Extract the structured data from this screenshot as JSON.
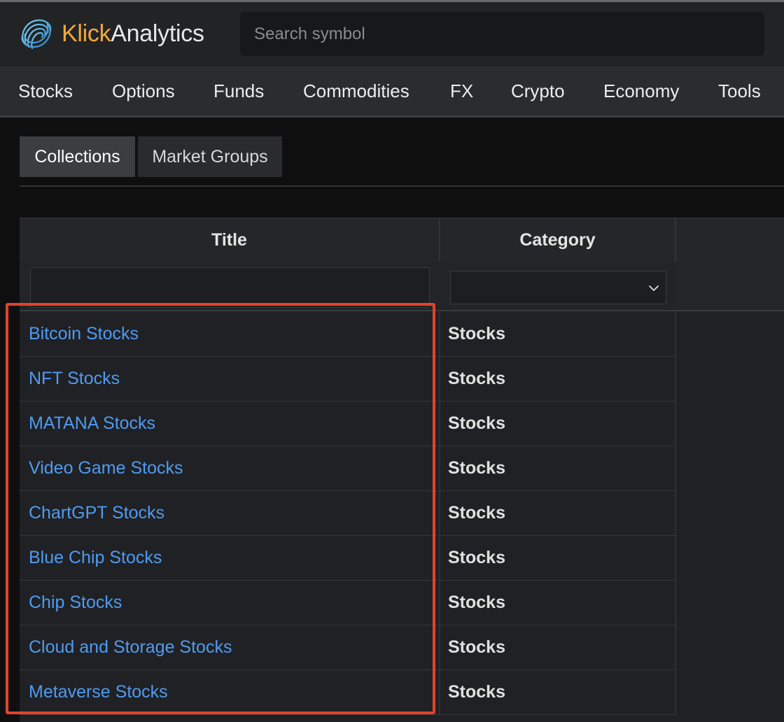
{
  "header": {
    "brand_part1": "Klick",
    "brand_part2": "Analytics",
    "search_placeholder": "Search symbol"
  },
  "nav": [
    "Stocks",
    "Options",
    "Funds",
    "Commodities",
    "FX",
    "Crypto",
    "Economy",
    "Tools"
  ],
  "tabs": [
    "Collections",
    "Market Groups"
  ],
  "grid": {
    "columns": [
      "Title",
      "Category"
    ],
    "rows": [
      {
        "title": "Bitcoin Stocks",
        "category": "Stocks"
      },
      {
        "title": "NFT Stocks",
        "category": "Stocks"
      },
      {
        "title": "MATANA Stocks",
        "category": "Stocks"
      },
      {
        "title": "Video Game Stocks",
        "category": "Stocks"
      },
      {
        "title": "ChartGPT Stocks",
        "category": "Stocks"
      },
      {
        "title": "Blue Chip Stocks",
        "category": "Stocks"
      },
      {
        "title": "Chip Stocks",
        "category": "Stocks"
      },
      {
        "title": "Cloud and Storage Stocks",
        "category": "Stocks"
      },
      {
        "title": "Metaverse Stocks",
        "category": "Stocks"
      }
    ]
  },
  "colors": {
    "brand_accent": "#f4a83b",
    "link": "#4f9bf2",
    "highlight": "#e2432b"
  }
}
